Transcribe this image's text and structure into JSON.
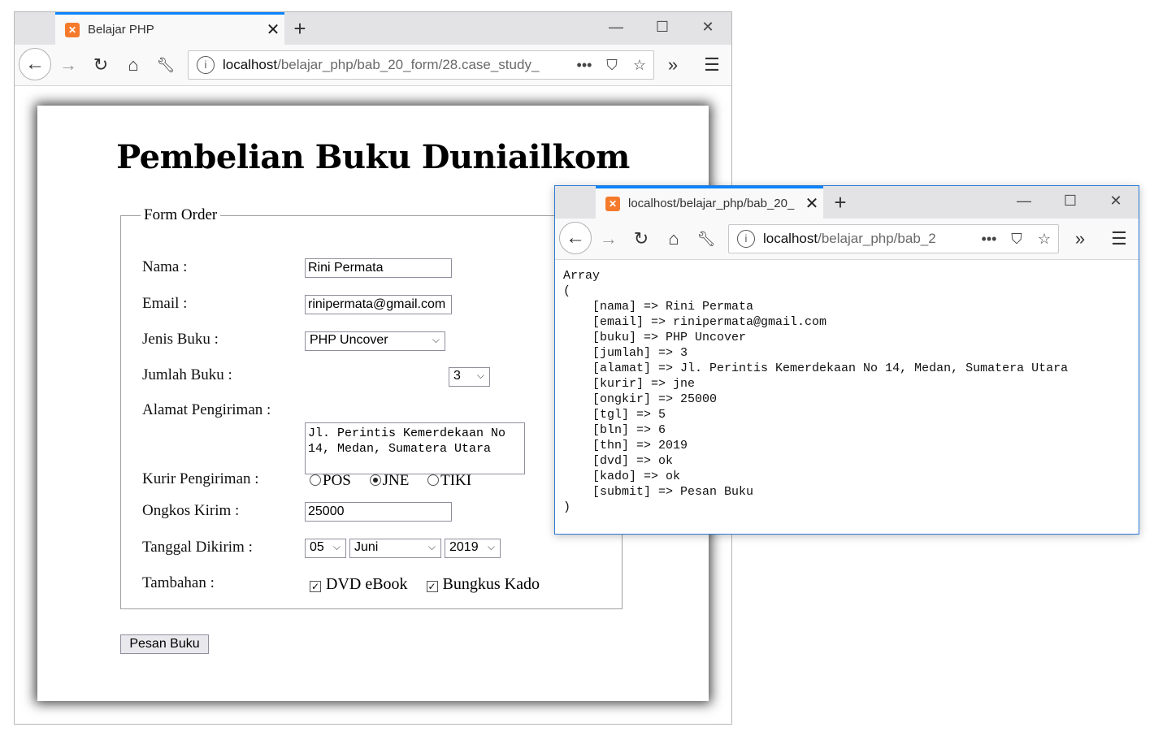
{
  "back_window": {
    "tab_title": "Belajar PHP",
    "url_host": "localhost",
    "url_path": "/belajar_php/bab_20_form/28.case_study_",
    "page": {
      "heading": "Pembelian Buku Duniailkom",
      "legend": "Form Order",
      "labels": {
        "nama": "Nama :",
        "email": "Email :",
        "jenis_buku": "Jenis Buku :",
        "jumlah_buku": "Jumlah Buku :",
        "alamat": "Alamat Pengiriman :",
        "kurir": "Kurir Pengiriman :",
        "ongkos": "Ongkos Kirim :",
        "tanggal": "Tanggal Dikirim :",
        "tambahan": "Tambahan :"
      },
      "values": {
        "nama": "Rini Permata",
        "email": "rinipermata@gmail.com",
        "jenis_buku": "PHP Uncover",
        "jumlah_buku": "3",
        "alamat": "Jl. Perintis Kemerdekaan No\n14, Medan, Sumatera Utara",
        "ongkos": "25000",
        "tgl": "05",
        "bln": "Juni",
        "thn": "2019"
      },
      "kurir_options": [
        {
          "label": "POS",
          "checked": false
        },
        {
          "label": "JNE",
          "checked": true
        },
        {
          "label": "TIKI",
          "checked": false
        }
      ],
      "tambahan_options": [
        {
          "label": "DVD eBook",
          "checked": true
        },
        {
          "label": "Bungkus Kado",
          "checked": true
        }
      ],
      "submit_label": "Pesan Buku"
    }
  },
  "front_window": {
    "tab_title": "localhost/belajar_php/bab_20_",
    "url_host": "localhost",
    "url_path": "/belajar_php/bab_2",
    "output_lines": [
      "Array",
      "(",
      "    [nama] => Rini Permata",
      "    [email] => rinipermata@gmail.com",
      "    [buku] => PHP Uncover",
      "    [jumlah] => 3",
      "    [alamat] => Jl. Perintis Kemerdekaan No 14, Medan, Sumatera Utara",
      "    [kurir] => jne",
      "    [ongkir] => 25000",
      "    [tgl] => 5",
      "    [bln] => 6",
      "    [thn] => 2019",
      "    [dvd] => ok",
      "    [kado] => ok",
      "    [submit] => Pesan Buku",
      ")"
    ]
  },
  "icons": {
    "back": "back-arrow-icon",
    "forward": "forward-arrow-icon",
    "reload": "reload-icon",
    "home": "home-icon",
    "tools": "wrench-icon",
    "info": "info-icon",
    "more": "more-dots-icon",
    "pocket": "pocket-icon",
    "bookmark": "star-icon",
    "overflow": "chevrons-right-icon",
    "menu": "hamburger-menu-icon"
  },
  "colors": {
    "tab_accent": "#0a84ff",
    "favicon": "#f57a2b",
    "front_window_border": "#2b7bd6"
  }
}
